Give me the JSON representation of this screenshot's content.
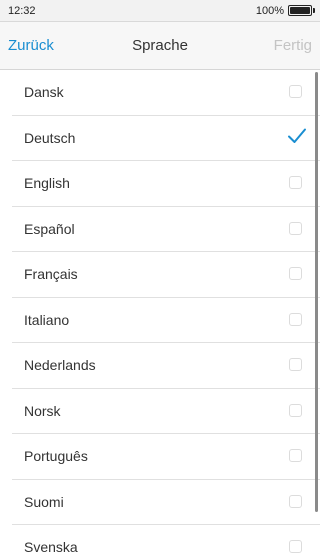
{
  "status_bar": {
    "time": "12:32",
    "battery_percent": "100%",
    "battery_level": 1.0
  },
  "nav": {
    "back_label": "Zurück",
    "title": "Sprache",
    "done_label": "Fertig"
  },
  "languages": [
    {
      "label": "Dansk",
      "selected": false
    },
    {
      "label": "Deutsch",
      "selected": true
    },
    {
      "label": "English",
      "selected": false
    },
    {
      "label": "Español",
      "selected": false
    },
    {
      "label": "Français",
      "selected": false
    },
    {
      "label": "Italiano",
      "selected": false
    },
    {
      "label": "Nederlands",
      "selected": false
    },
    {
      "label": "Norsk",
      "selected": false
    },
    {
      "label": "Português",
      "selected": false
    },
    {
      "label": "Suomi",
      "selected": false
    },
    {
      "label": "Svenska",
      "selected": false
    }
  ],
  "colors": {
    "accent": "#1a8ed1",
    "disabled": "#c4c4c4",
    "check": "#1a8ed1"
  },
  "icons": {
    "selected": "checkmark-icon",
    "unselected": "checkbox-empty-icon",
    "battery": "battery-icon"
  }
}
